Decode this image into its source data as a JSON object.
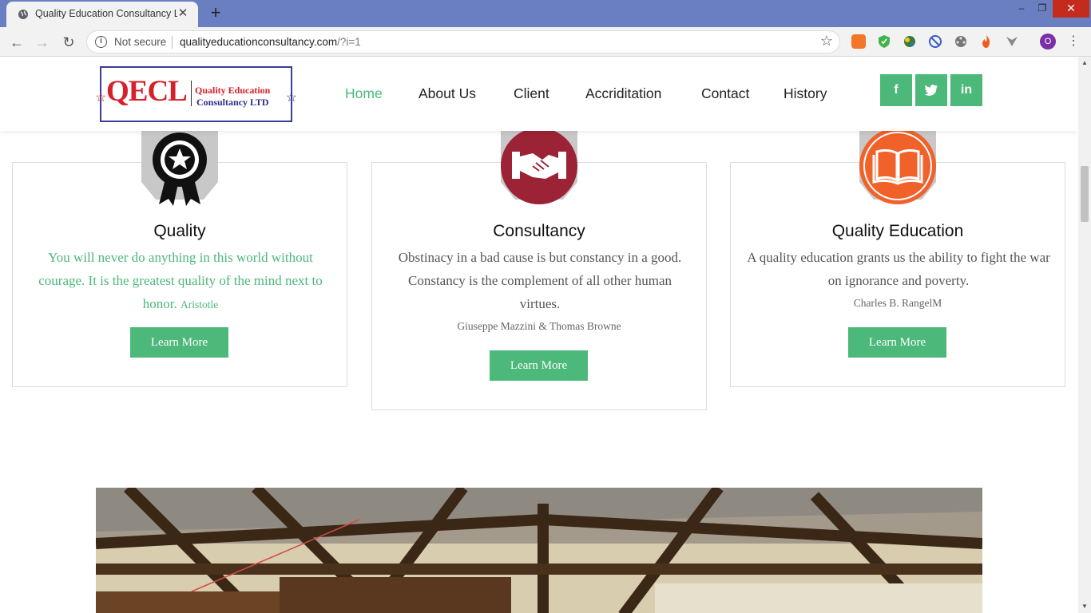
{
  "browser": {
    "tab_title": "Quality Education Consultancy Lt",
    "new_tab_symbol": "+",
    "address": {
      "security_label": "Not secure",
      "host": "qualityeducationconsultancy.com",
      "path": "/?i=1"
    },
    "profile_initial": "O",
    "window_controls": {
      "minimize": "–",
      "maximize": "❐",
      "close": "✕"
    },
    "extensions": [
      "download-icon",
      "shield-icon",
      "globe-icon",
      "block-icon",
      "film-icon",
      "fire-icon",
      "vpn-icon"
    ]
  },
  "site": {
    "logo": {
      "letters": "QECL",
      "line1": "Quality Education",
      "line2": "Consultancy LTD"
    },
    "nav": [
      {
        "label": "Home",
        "active": true
      },
      {
        "label": "About Us"
      },
      {
        "label": "Client"
      },
      {
        "label": "Accriditation"
      },
      {
        "label": "Contact"
      },
      {
        "label": "History"
      }
    ],
    "social": [
      {
        "icon": "facebook-icon",
        "glyph": "f"
      },
      {
        "icon": "twitter-icon",
        "glyph": "🐦"
      },
      {
        "icon": "linkedin-icon",
        "glyph": "in"
      }
    ],
    "cards": [
      {
        "title": "Quality",
        "quote": "You will never do anything in this world without courage. It is the greatest quality of the mind next to honor.",
        "author": "Aristotle",
        "button": "Learn More",
        "icon": "award-ribbon-icon"
      },
      {
        "title": "Consultancy",
        "quote": "Obstinacy in a bad cause is but constancy in a good. Constancy is the complement of all other human virtues.",
        "author": "Giuseppe Mazzini & Thomas Browne",
        "button": "Learn More",
        "icon": "handshake-icon"
      },
      {
        "title": "Quality Education",
        "quote": "A quality education grants us the ability to fight the war on ignorance and poverty.",
        "author": "Charles B. RangelM",
        "button": "Learn More",
        "icon": "book-icon"
      }
    ],
    "colors": {
      "accent_green": "#4cb87a",
      "chrome_title": "#6a7fc1",
      "consultancy_red": "#9b2335",
      "education_orange": "#f0622a"
    }
  }
}
